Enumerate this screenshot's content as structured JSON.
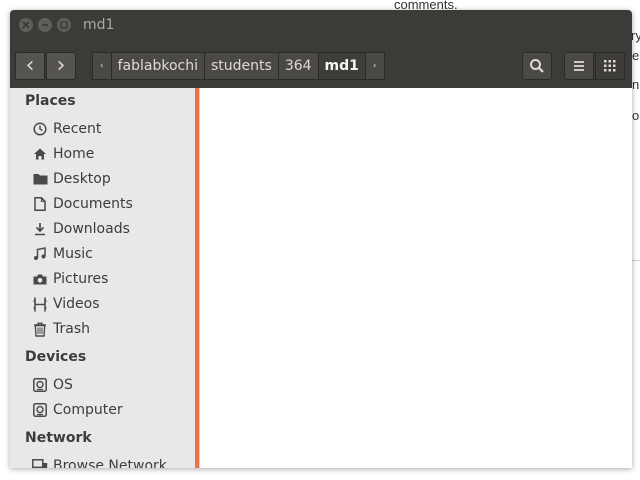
{
  "background": {
    "fragments": [
      "comments.",
      "ry",
      "e",
      "n",
      "o"
    ]
  },
  "window": {
    "title": "md1"
  },
  "toolbar": {
    "back_glyph": "‹",
    "forward_glyph": "›",
    "breadcrumbs": [
      "fablabkochi",
      "students",
      "364",
      "md1"
    ],
    "crumb_left_glyph": "‹",
    "crumb_right_glyph": "›"
  },
  "sidebar": {
    "places_label": "Places",
    "places": [
      {
        "label": "Recent",
        "icon": "clock-icon"
      },
      {
        "label": "Home",
        "icon": "home-icon"
      },
      {
        "label": "Desktop",
        "icon": "folder-icon"
      },
      {
        "label": "Documents",
        "icon": "document-icon"
      },
      {
        "label": "Downloads",
        "icon": "download-icon"
      },
      {
        "label": "Music",
        "icon": "music-icon"
      },
      {
        "label": "Pictures",
        "icon": "camera-icon"
      },
      {
        "label": "Videos",
        "icon": "film-icon"
      },
      {
        "label": "Trash",
        "icon": "trash-icon"
      }
    ],
    "devices_label": "Devices",
    "devices": [
      {
        "label": "OS",
        "icon": "drive-icon"
      },
      {
        "label": "Computer",
        "icon": "drive-icon"
      }
    ],
    "network_label": "Network",
    "network": [
      {
        "label": "Browse Network",
        "icon": "network-icon"
      }
    ]
  },
  "colors": {
    "titlebar": "#3c3b37",
    "sidebar": "#e9e8e6",
    "accent": "#e9744a"
  }
}
